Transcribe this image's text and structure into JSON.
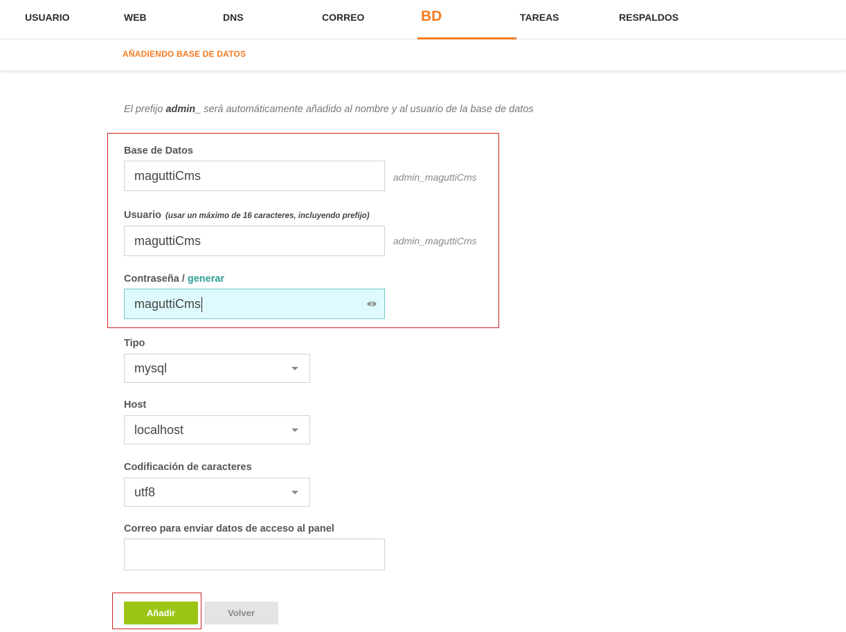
{
  "nav": {
    "tabs": [
      {
        "label": "USUARIO"
      },
      {
        "label": "WEB"
      },
      {
        "label": "DNS"
      },
      {
        "label": "CORREO"
      },
      {
        "label": "BD",
        "active": true
      },
      {
        "label": "TAREAS"
      },
      {
        "label": "RESPALDOS"
      }
    ]
  },
  "subheader": {
    "title": "AÑADIENDO BASE DE DATOS"
  },
  "hint": {
    "before": "El prefijo ",
    "prefix": "admin_",
    "after": " será automáticamente añadido al nombre y al usuario de la base de datos"
  },
  "form": {
    "database": {
      "label": "Base de Datos",
      "value": "maguttiCms",
      "suffix": "admin_maguttiCms"
    },
    "user": {
      "label": "Usuario",
      "note": "(usar un máximo de 16 caracteres, incluyendo prefijo)",
      "value": "maguttiCms",
      "suffix": "admin_maguttiCms"
    },
    "password": {
      "label": "Contraseña / ",
      "generate": "generar",
      "value": "maguttiCms",
      "icon": "eye-icon"
    },
    "type": {
      "label": "Tipo",
      "value": "mysql"
    },
    "host": {
      "label": "Host",
      "value": "localhost"
    },
    "charset": {
      "label": "Codificación de caracteres",
      "value": "utf8"
    },
    "email": {
      "label": "Correo para enviar datos de acceso al panel",
      "value": ""
    }
  },
  "buttons": {
    "add": "Añadir",
    "back": "Volver"
  },
  "colors": {
    "accent": "#f47a20",
    "link": "#2d9f94",
    "add_button": "#9cc414",
    "highlight": "#cc1f1f",
    "focus_bg": "#dffaff"
  }
}
